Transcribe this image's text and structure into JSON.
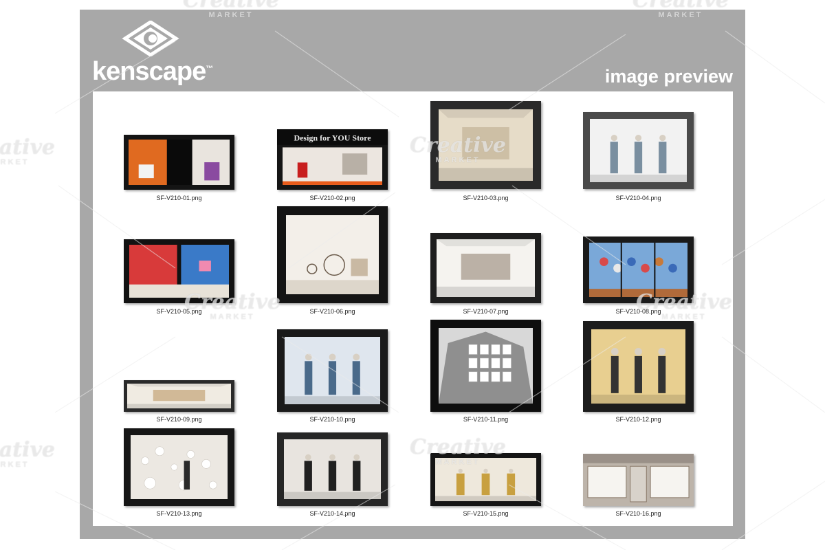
{
  "brand": {
    "name": "kenscape",
    "trademark": "™"
  },
  "header": {
    "preview_label": "image preview"
  },
  "watermark": {
    "text": "Creative",
    "subtext": "MARKET"
  },
  "thumbnails": [
    {
      "filename": "SF-V210-01.png",
      "signage": ""
    },
    {
      "filename": "SF-V210-02.png",
      "signage": "Design for YOU Store"
    },
    {
      "filename": "SF-V210-03.png",
      "signage": ""
    },
    {
      "filename": "SF-V210-04.png",
      "signage": ""
    },
    {
      "filename": "SF-V210-05.png",
      "signage": ""
    },
    {
      "filename": "SF-V210-06.png",
      "signage": ""
    },
    {
      "filename": "SF-V210-07.png",
      "signage": ""
    },
    {
      "filename": "SF-V210-08.png",
      "signage": ""
    },
    {
      "filename": "SF-V210-09.png",
      "signage": ""
    },
    {
      "filename": "SF-V210-10.png",
      "signage": ""
    },
    {
      "filename": "SF-V210-11.png",
      "signage": ""
    },
    {
      "filename": "SF-V210-12.png",
      "signage": ""
    },
    {
      "filename": "SF-V210-13.png",
      "signage": ""
    },
    {
      "filename": "SF-V210-14.png",
      "signage": ""
    },
    {
      "filename": "SF-V210-15.png",
      "signage": ""
    },
    {
      "filename": "SF-V210-16.png",
      "signage": ""
    }
  ],
  "colors": {
    "frame": "#a8a8a8",
    "panel": "#ffffff",
    "brand_text": "#ffffff"
  }
}
